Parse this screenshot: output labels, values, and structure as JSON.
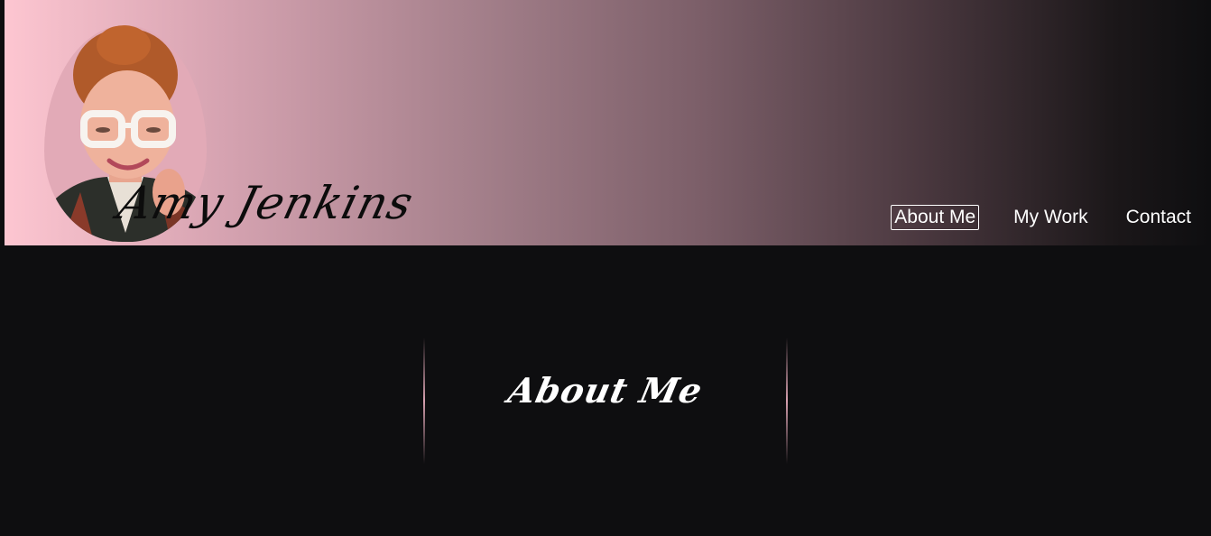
{
  "header": {
    "signature": "Amy Jenkins",
    "avatar_icon": "portrait-photo"
  },
  "nav": {
    "items": [
      {
        "label": "About Me",
        "active": true
      },
      {
        "label": "My Work",
        "active": false
      },
      {
        "label": "Contact",
        "active": false
      }
    ]
  },
  "main": {
    "section_title": "About Me"
  },
  "colors": {
    "gradient_start": "#fdc6d1",
    "gradient_end": "#0e0e10",
    "background": "#0e0e10",
    "accent_line": "#d6a0af",
    "nav_text": "#ffffff"
  }
}
